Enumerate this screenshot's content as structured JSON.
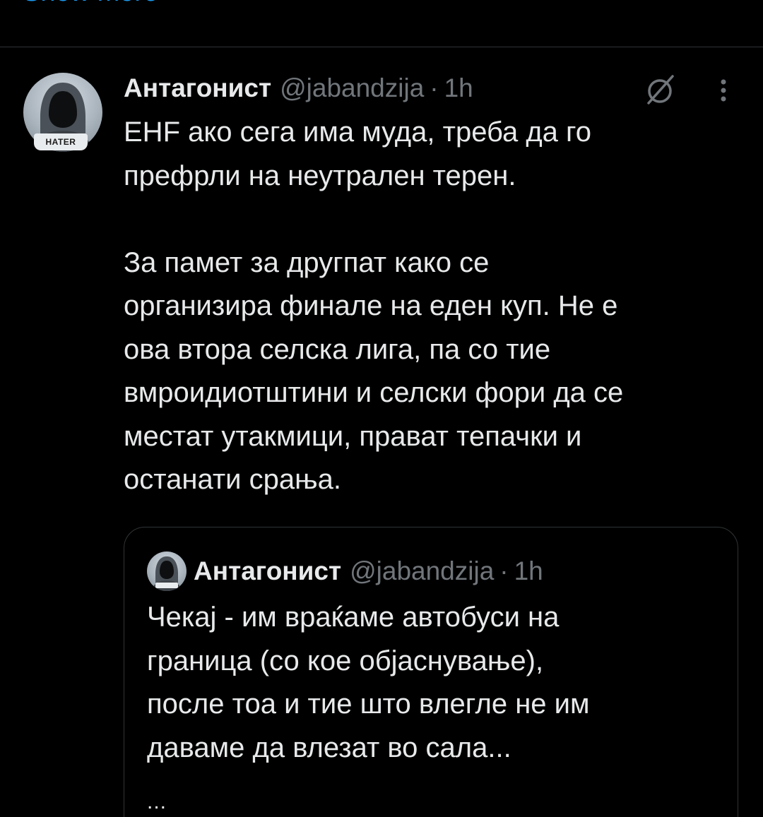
{
  "top": {
    "show_more_label": "Show more"
  },
  "tweet": {
    "author": {
      "display_name": "Антагонист",
      "handle": "@jabandzija",
      "avatar_badge": "HATER"
    },
    "separator": "·",
    "time": "1h",
    "grok_icon": "grok-slash-icon",
    "more_icon": "more-vertical-icon",
    "text": "ЕНF ако сега има муда, треба да го\nпрефрли на неутрален терен.\n\nЗа памет за другпат како се\nорганизира финале на еден куп. Не е\nова втора селска лига, па со тие\nвмроидиотштини и селски фори да се\nместат утакмици, прават тепачки и\nостанати срања."
  },
  "quote": {
    "author": {
      "display_name": "Антагонист",
      "handle": "@jabandzija"
    },
    "separator": "·",
    "time": "1h",
    "text": "Чекај - им враќаме автобуси на\nграница (со кое објаснување),\nпосле тоа и тие што влегле не им\nдаваме да влезат во сала...",
    "ellipsis": "..."
  },
  "colors": {
    "background": "#000000",
    "text_primary": "#e7e9ea",
    "text_secondary": "#71767b",
    "divider": "#2f3336",
    "link": "#1d9bf0"
  }
}
